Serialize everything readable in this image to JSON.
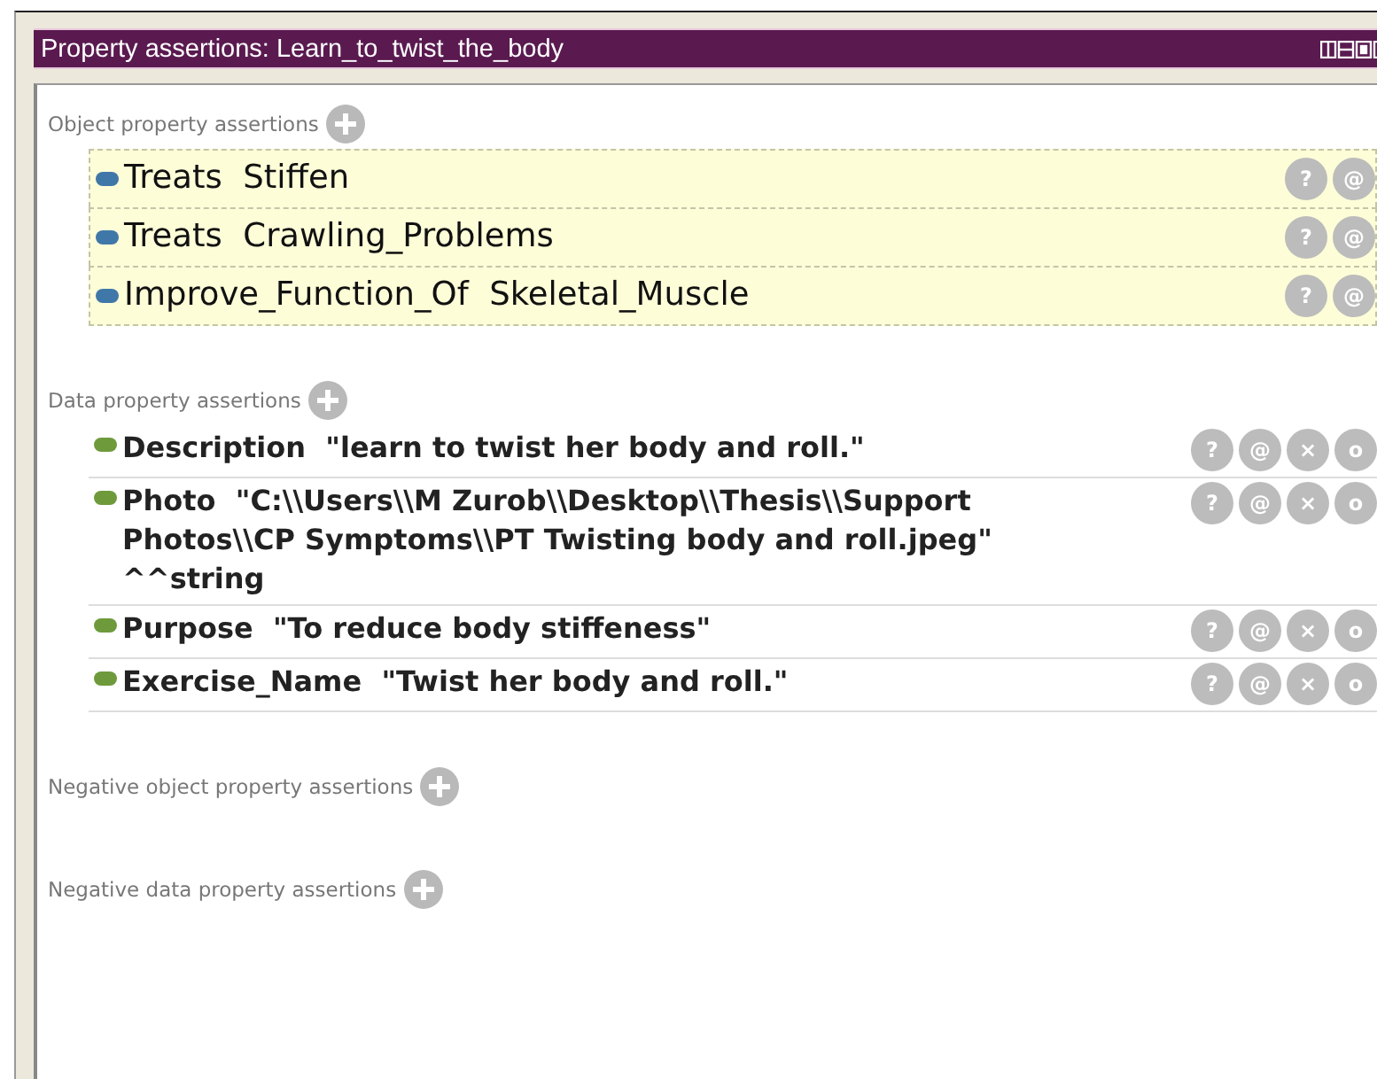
{
  "window": {
    "title": "Property assertions: Learn_to_twist_the_body"
  },
  "sections": [
    {
      "label": "Object property assertions",
      "kind": "object",
      "items": [
        {
          "text": "Treats  Stiffen",
          "buttons": [
            "?",
            "@"
          ]
        },
        {
          "text": "Treats  Crawling_Problems",
          "buttons": [
            "?",
            "@"
          ]
        },
        {
          "text": "Improve_Function_Of  Skeletal_Muscle",
          "buttons": [
            "?",
            "@"
          ]
        }
      ]
    },
    {
      "label": "Data property assertions",
      "kind": "data",
      "items": [
        {
          "text": "Description  \"learn to twist her body and roll.\"",
          "buttons": [
            "?",
            "@",
            "×",
            "o"
          ]
        },
        {
          "text": "Photo  \"C:\\\\Users\\\\M Zurob\\\\Desktop\\\\Thesis\\\\Support Photos\\\\CP Symptoms\\\\PT Twisting body and roll.jpeg\" ^^string",
          "buttons": [
            "?",
            "@",
            "×",
            "o"
          ]
        },
        {
          "text": "Purpose  \"To reduce body stiffeness\"",
          "buttons": [
            "?",
            "@",
            "×",
            "o"
          ]
        },
        {
          "text": "Exercise_Name  \"Twist her body and roll.\"",
          "buttons": [
            "?",
            "@",
            "×",
            "o"
          ]
        }
      ]
    },
    {
      "label": "Negative object property assertions"
    },
    {
      "label": "Negative data property assertions"
    }
  ]
}
